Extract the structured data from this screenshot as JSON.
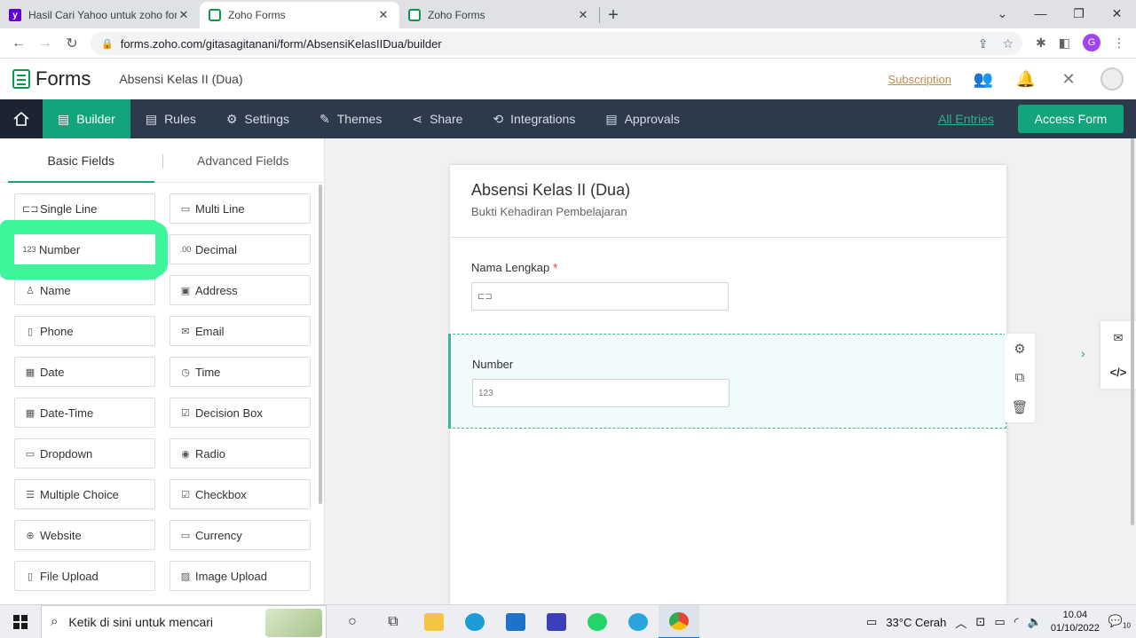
{
  "browser": {
    "tabs": [
      {
        "title": "Hasil Cari Yahoo untuk zoho form",
        "favicon": "yahoo",
        "active": false
      },
      {
        "title": "Zoho Forms",
        "favicon": "zoho",
        "active": true
      },
      {
        "title": "Zoho Forms",
        "favicon": "zoho",
        "active": false
      }
    ],
    "url": "forms.zoho.com/gitasagitanani/form/AbsensiKelasIIDua/builder",
    "profile_initial": "G"
  },
  "header": {
    "app_name": "Forms",
    "form_name": "Absensi Kelas II (Dua)",
    "subscription": "Subscription"
  },
  "toolbar": {
    "items": [
      {
        "label": "Builder",
        "icon": "builder-icon"
      },
      {
        "label": "Rules",
        "icon": "rules-icon"
      },
      {
        "label": "Settings",
        "icon": "gear-icon"
      },
      {
        "label": "Themes",
        "icon": "themes-icon"
      },
      {
        "label": "Share",
        "icon": "share-icon"
      },
      {
        "label": "Integrations",
        "icon": "integrations-icon"
      },
      {
        "label": "Approvals",
        "icon": "approvals-icon"
      }
    ],
    "all_entries": "All Entries",
    "access_form": "Access Form"
  },
  "fields_panel": {
    "tabs": [
      "Basic Fields",
      "Advanced Fields"
    ],
    "fields": [
      {
        "label": "Single Line",
        "icon_text": "⊏⊐"
      },
      {
        "label": "Multi Line",
        "icon_text": "▭"
      },
      {
        "label": "Number",
        "icon_text": "123"
      },
      {
        "label": "Decimal",
        "icon_text": ".00"
      },
      {
        "label": "Name",
        "icon_text": "♙"
      },
      {
        "label": "Address",
        "icon_text": "▣"
      },
      {
        "label": "Phone",
        "icon_text": "▯"
      },
      {
        "label": "Email",
        "icon_text": "✉"
      },
      {
        "label": "Date",
        "icon_text": "▦"
      },
      {
        "label": "Time",
        "icon_text": "◷"
      },
      {
        "label": "Date-Time",
        "icon_text": "▦"
      },
      {
        "label": "Decision Box",
        "icon_text": "☑"
      },
      {
        "label": "Dropdown",
        "icon_text": "▭"
      },
      {
        "label": "Radio",
        "icon_text": "◉"
      },
      {
        "label": "Multiple Choice",
        "icon_text": "☰"
      },
      {
        "label": "Checkbox",
        "icon_text": "☑"
      },
      {
        "label": "Website",
        "icon_text": "⊕"
      },
      {
        "label": "Currency",
        "icon_text": "▭"
      },
      {
        "label": "File Upload",
        "icon_text": "▯"
      },
      {
        "label": "Image Upload",
        "icon_text": "▨"
      }
    ]
  },
  "form": {
    "title": "Absensi Kelas II (Dua)",
    "subtitle": "Bukti Kehadiran Pembelajaran",
    "q1": {
      "label": "Nama Lengkap",
      "required_mark": "*",
      "placeholder_icon": "⊏⊐"
    },
    "q2": {
      "label": "Number",
      "placeholder_icon": "123"
    }
  },
  "taskbar": {
    "search_placeholder": "Ketik di sini untuk mencari",
    "weather": "33°C  Cerah",
    "time": "10.04",
    "date": "01/10/2022",
    "notifications": "10"
  }
}
